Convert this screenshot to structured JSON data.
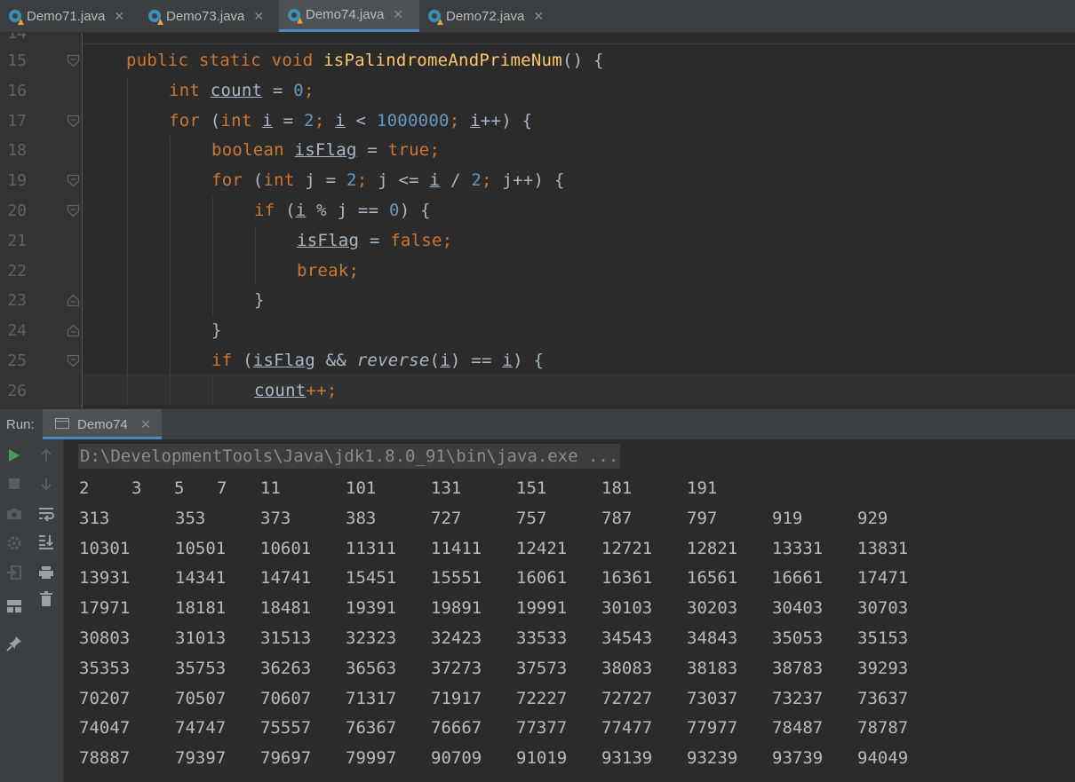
{
  "tabs": [
    {
      "label": "Demo71.java",
      "active": false
    },
    {
      "label": "Demo73.java",
      "active": false
    },
    {
      "label": "Demo74.java",
      "active": true
    },
    {
      "label": "Demo72.java",
      "active": false
    }
  ],
  "editor": {
    "partial_line_number": "14",
    "lines": [
      {
        "num": "15",
        "fold": "open",
        "tokens": [
          {
            "t": "public static void ",
            "c": "kw"
          },
          {
            "t": "isPalindromeAndPrimeNum",
            "c": "fn"
          },
          {
            "t": "() {"
          }
        ]
      },
      {
        "num": "16",
        "fold": "none",
        "tokens": [
          {
            "t": "int ",
            "c": "kw"
          },
          {
            "t": "count",
            "c": "ul"
          },
          {
            "t": " = "
          },
          {
            "t": "0",
            "c": "num"
          },
          {
            "t": ";",
            "c": "kw"
          }
        ]
      },
      {
        "num": "17",
        "fold": "open",
        "tokens": [
          {
            "t": "for ",
            "c": "kw"
          },
          {
            "t": "("
          },
          {
            "t": "int ",
            "c": "kw"
          },
          {
            "t": "i",
            "c": "ul"
          },
          {
            "t": " = "
          },
          {
            "t": "2",
            "c": "num"
          },
          {
            "t": "; ",
            "c": "kw"
          },
          {
            "t": "i",
            "c": "ul"
          },
          {
            "t": " < "
          },
          {
            "t": "1000000",
            "c": "num"
          },
          {
            "t": "; ",
            "c": "kw"
          },
          {
            "t": "i",
            "c": "ul"
          },
          {
            "t": "++) {"
          }
        ]
      },
      {
        "num": "18",
        "fold": "none",
        "tokens": [
          {
            "t": "boolean ",
            "c": "kw"
          },
          {
            "t": "isFlag",
            "c": "ul"
          },
          {
            "t": " = "
          },
          {
            "t": "true",
            "c": "kw"
          },
          {
            "t": ";",
            "c": "kw"
          }
        ]
      },
      {
        "num": "19",
        "fold": "open",
        "tokens": [
          {
            "t": "for ",
            "c": "kw"
          },
          {
            "t": "("
          },
          {
            "t": "int ",
            "c": "kw"
          },
          {
            "t": "j = "
          },
          {
            "t": "2",
            "c": "num"
          },
          {
            "t": "; ",
            "c": "kw"
          },
          {
            "t": "j <= "
          },
          {
            "t": "i",
            "c": "ul"
          },
          {
            "t": " / "
          },
          {
            "t": "2",
            "c": "num"
          },
          {
            "t": "; ",
            "c": "kw"
          },
          {
            "t": "j++) {"
          }
        ]
      },
      {
        "num": "20",
        "fold": "open",
        "tokens": [
          {
            "t": "if ",
            "c": "kw"
          },
          {
            "t": "("
          },
          {
            "t": "i",
            "c": "ul"
          },
          {
            "t": " % j == "
          },
          {
            "t": "0",
            "c": "num"
          },
          {
            "t": ") {"
          }
        ]
      },
      {
        "num": "21",
        "fold": "none",
        "tokens": [
          {
            "t": "isFlag",
            "c": "ul"
          },
          {
            "t": " = "
          },
          {
            "t": "false",
            "c": "kw"
          },
          {
            "t": ";",
            "c": "kw"
          }
        ]
      },
      {
        "num": "22",
        "fold": "none",
        "tokens": [
          {
            "t": "break",
            "c": "kw"
          },
          {
            "t": ";",
            "c": "kw"
          }
        ]
      },
      {
        "num": "23",
        "fold": "close",
        "tokens": [
          {
            "t": "}"
          }
        ]
      },
      {
        "num": "24",
        "fold": "close",
        "tokens": [
          {
            "t": "}"
          }
        ]
      },
      {
        "num": "25",
        "fold": "open",
        "tokens": [
          {
            "t": "if ",
            "c": "kw"
          },
          {
            "t": "("
          },
          {
            "t": "isFlag",
            "c": "ul"
          },
          {
            "t": " && "
          },
          {
            "t": "reverse",
            "c": "it"
          },
          {
            "t": "("
          },
          {
            "t": "i",
            "c": "ul"
          },
          {
            "t": ") == "
          },
          {
            "t": "i",
            "c": "ul"
          },
          {
            "t": ") {"
          }
        ]
      },
      {
        "num": "26",
        "fold": "none",
        "tokens": [
          {
            "t": "count",
            "c": "ul"
          },
          {
            "t": "++;",
            "c": "kw"
          }
        ]
      }
    ]
  },
  "run": {
    "label": "Run:",
    "tab_label": "Demo74",
    "command": "D:\\DevelopmentTools\\Java\\jdk1.8.0_91\\bin\\java.exe ...",
    "first_row": [
      "2",
      "3",
      "5",
      "7",
      "11",
      "101",
      "131",
      "151",
      "181",
      "191"
    ],
    "rows": [
      [
        "313",
        "353",
        "373",
        "383",
        "727",
        "757",
        "787",
        "797",
        "919",
        "929"
      ],
      [
        "10301",
        "10501",
        "10601",
        "11311",
        "11411",
        "12421",
        "12721",
        "12821",
        "13331",
        "13831"
      ],
      [
        "13931",
        "14341",
        "14741",
        "15451",
        "15551",
        "16061",
        "16361",
        "16561",
        "16661",
        "17471"
      ],
      [
        "17971",
        "18181",
        "18481",
        "19391",
        "19891",
        "19991",
        "30103",
        "30203",
        "30403",
        "30703"
      ],
      [
        "30803",
        "31013",
        "31513",
        "32323",
        "32423",
        "33533",
        "34543",
        "34843",
        "35053",
        "35153"
      ],
      [
        "35353",
        "35753",
        "36263",
        "36563",
        "37273",
        "37573",
        "38083",
        "38183",
        "38783",
        "39293"
      ],
      [
        "70207",
        "70507",
        "70607",
        "71317",
        "71917",
        "72227",
        "72727",
        "73037",
        "73237",
        "73637"
      ],
      [
        "74047",
        "74747",
        "75557",
        "76367",
        "76667",
        "77377",
        "77477",
        "77977",
        "78487",
        "78787"
      ],
      [
        "78887",
        "79397",
        "79697",
        "79997",
        "90709",
        "91019",
        "93139",
        "93239",
        "93739",
        "94049"
      ]
    ]
  },
  "sidebar_icons": {
    "column1": [
      "run-icon",
      "stop-icon",
      "camera-icon",
      "settings-icon",
      "exit-icon",
      "layout-icon",
      "pin-icon"
    ],
    "column2": [
      "arrow-up-icon",
      "arrow-down-icon",
      "soft-wrap-icon",
      "scroll-to-end-icon",
      "print-icon",
      "trash-icon"
    ]
  },
  "colors": {
    "background": "#2b2b2b",
    "keyword": "#cc7832",
    "function": "#ffc66d",
    "number": "#6897bb",
    "text": "#a9b7c6",
    "accent": "#4a88c7",
    "run_green": "#499c54"
  }
}
